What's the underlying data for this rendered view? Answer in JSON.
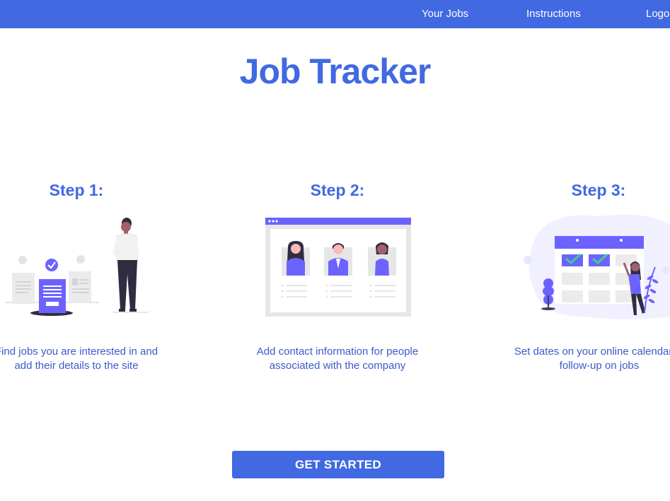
{
  "nav": {
    "your_jobs": "Your Jobs",
    "instructions": "Instructions",
    "logout": "Logout"
  },
  "page_title": "Job Tracker",
  "steps": [
    {
      "heading": "Step 1:",
      "desc_line1": "Find jobs you are interested in and",
      "desc_line2": "add their details to the site",
      "illustration": "job-search-illustration"
    },
    {
      "heading": "Step 2:",
      "desc_line1": "Add contact information for people",
      "desc_line2": "associated with the company",
      "illustration": "contacts-browser-illustration"
    },
    {
      "heading": "Step 3:",
      "desc_line1": "Set dates on your online calendar to",
      "desc_line2": "follow-up on jobs",
      "illustration": "calendar-illustration"
    }
  ],
  "cta_label": "GET STARTED",
  "colors": {
    "brand": "#4169e1",
    "accent": "#6c63ff",
    "check": "#3ecf8e"
  }
}
